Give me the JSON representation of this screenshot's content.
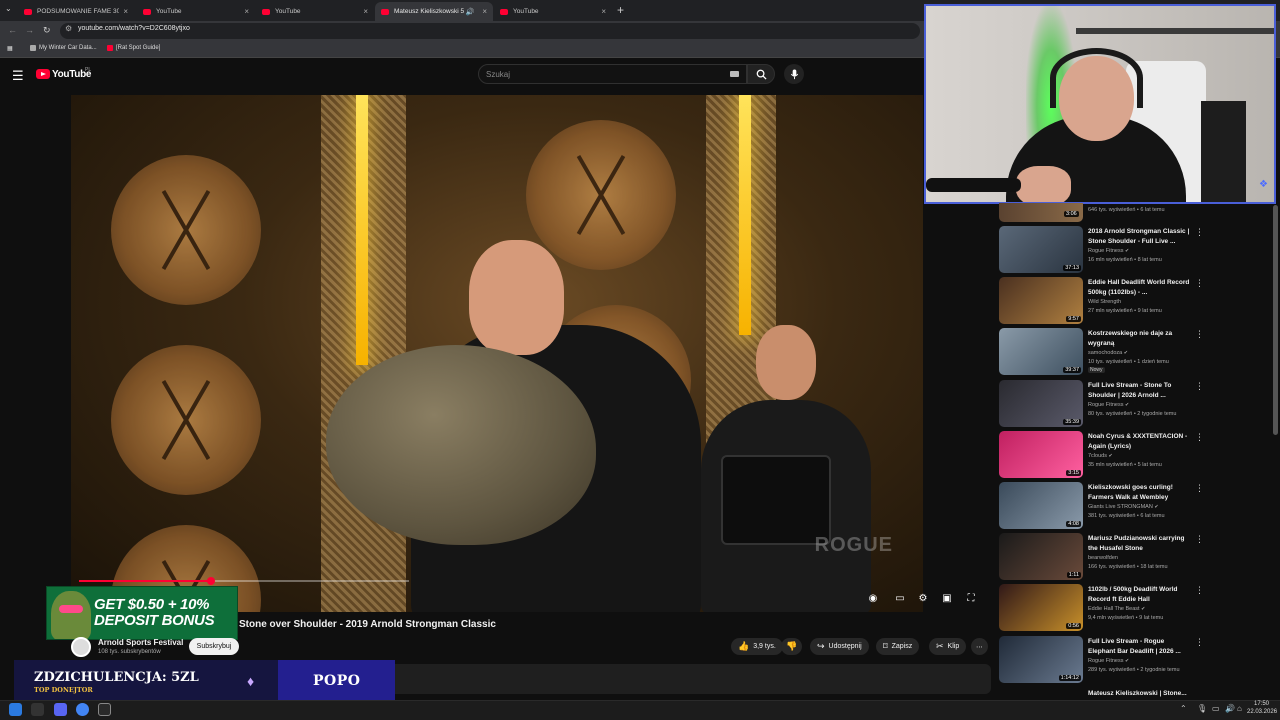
{
  "browser": {
    "tabs": [
      {
        "title": "PODSUMOWANIE FAME 30 (DO",
        "active": false
      },
      {
        "title": "YouTube",
        "active": false
      },
      {
        "title": "YouTube",
        "active": false
      },
      {
        "title": "Mateusz Kieliszkowski 5 Re",
        "active": true
      },
      {
        "title": "YouTube",
        "active": false
      }
    ],
    "url": "youtube.com/watch?v=D2C608ytjxo",
    "bookmarks": [
      "My Winter Car Data...",
      "[Rat Spot Guide]"
    ]
  },
  "youtube": {
    "wordmark": "YouTube",
    "country": "PL",
    "search_placeholder": "Szukaj"
  },
  "player": {
    "watermark": "ROGUE",
    "progress_fraction": 0.4
  },
  "video": {
    "title": "Stone over Shoulder - 2019 Arnold Strongman Classic",
    "channel": "Arnold Sports Festival",
    "subscribers": "108 tys. subskrybentów",
    "subscribe_label": "Subskrybuj",
    "likes": "3,9 tys.",
    "share_label": "Udostępnij",
    "save_label": "Zapisz",
    "clip_label": "Klip"
  },
  "recommendations": {
    "partial": {
      "meta": "646 tys. wyświetleń • 6 lat temu",
      "duration": "3:06"
    },
    "items": [
      {
        "title": "2018 Arnold Strongman Classic | Stone Shoulder - Full Live ...",
        "channel": "Rogue Fitness",
        "verified": true,
        "meta": "16 mln wyświetleń • 8 lat temu",
        "duration": "37:13",
        "badge": ""
      },
      {
        "title": "Eddie Hall Deadlift World Record 500kg (1102lbs) - ...",
        "channel": "Wild Strength",
        "verified": false,
        "meta": "27 mln wyświetleń • 9 lat temu",
        "duration": "9:57",
        "badge": ""
      },
      {
        "title": "Kostrzewskiego nie daje za wygraną",
        "channel": "samochodoza",
        "verified": true,
        "meta": "10 tys. wyświetleń • 1 dzień temu",
        "duration": "39:37",
        "badge": "Nowy"
      },
      {
        "title": "Full Live Stream - Stone To Shoulder | 2026 Arnold ...",
        "channel": "Rogue Fitness",
        "verified": true,
        "meta": "80 tys. wyświetleń • 2 tygodnie temu",
        "duration": "35:39",
        "badge": ""
      },
      {
        "title": "Noah Cyrus & XXXTENTACION - Again (Lyrics)",
        "channel": "7clouds",
        "verified": true,
        "meta": "35 mln wyświetleń • 5 lat temu",
        "duration": "3:15",
        "badge": ""
      },
      {
        "title": "Kieliszkowski goes curling! Farmers Walk at Wembley",
        "channel": "Giants Live STRONGMAN",
        "verified": true,
        "meta": "381 tys. wyświetleń • 6 lat temu",
        "duration": "4:08",
        "badge": ""
      },
      {
        "title": "Mariusz Pudzianowski carrying the Husafel Stone",
        "channel": "bearwolfden",
        "verified": false,
        "meta": "166 tys. wyświetleń • 18 lat temu",
        "duration": "1:11",
        "badge": ""
      },
      {
        "title": "1102lb / 500kg Deadlift World Record ft Eddie Hall",
        "channel": "Eddie Hall The Beast",
        "verified": true,
        "meta": "9,4 mln wyświetleń • 9 lat temu",
        "duration": "0:56",
        "badge": ""
      },
      {
        "title": "Full Live Stream - Rogue Elephant Bar Deadlift | 2026 ...",
        "channel": "Rogue Fitness",
        "verified": true,
        "meta": "289 tys. wyświetleń • 2 tygodnie temu",
        "duration": "1:14:12",
        "badge": ""
      }
    ],
    "last_partial_title": "Mateusz Kieliszkowski | Stone..."
  },
  "ad": {
    "line1": "GET $0.50 + 10%",
    "line2": "DEPOSIT BONUS"
  },
  "donation": {
    "title": "ZDZICHULENCJA: 5ZL",
    "subtitle": "TOP DONEJTOR",
    "name": "POPO"
  },
  "taskbar": {
    "time": "17:50",
    "date": "22.03.2026"
  },
  "colors": {
    "brand_red": "#ff0033",
    "webcam_border": "#4a5fd8",
    "donation_left": "#15153f",
    "donation_right": "#231f8f",
    "ad_green": "#0e6f3a"
  }
}
